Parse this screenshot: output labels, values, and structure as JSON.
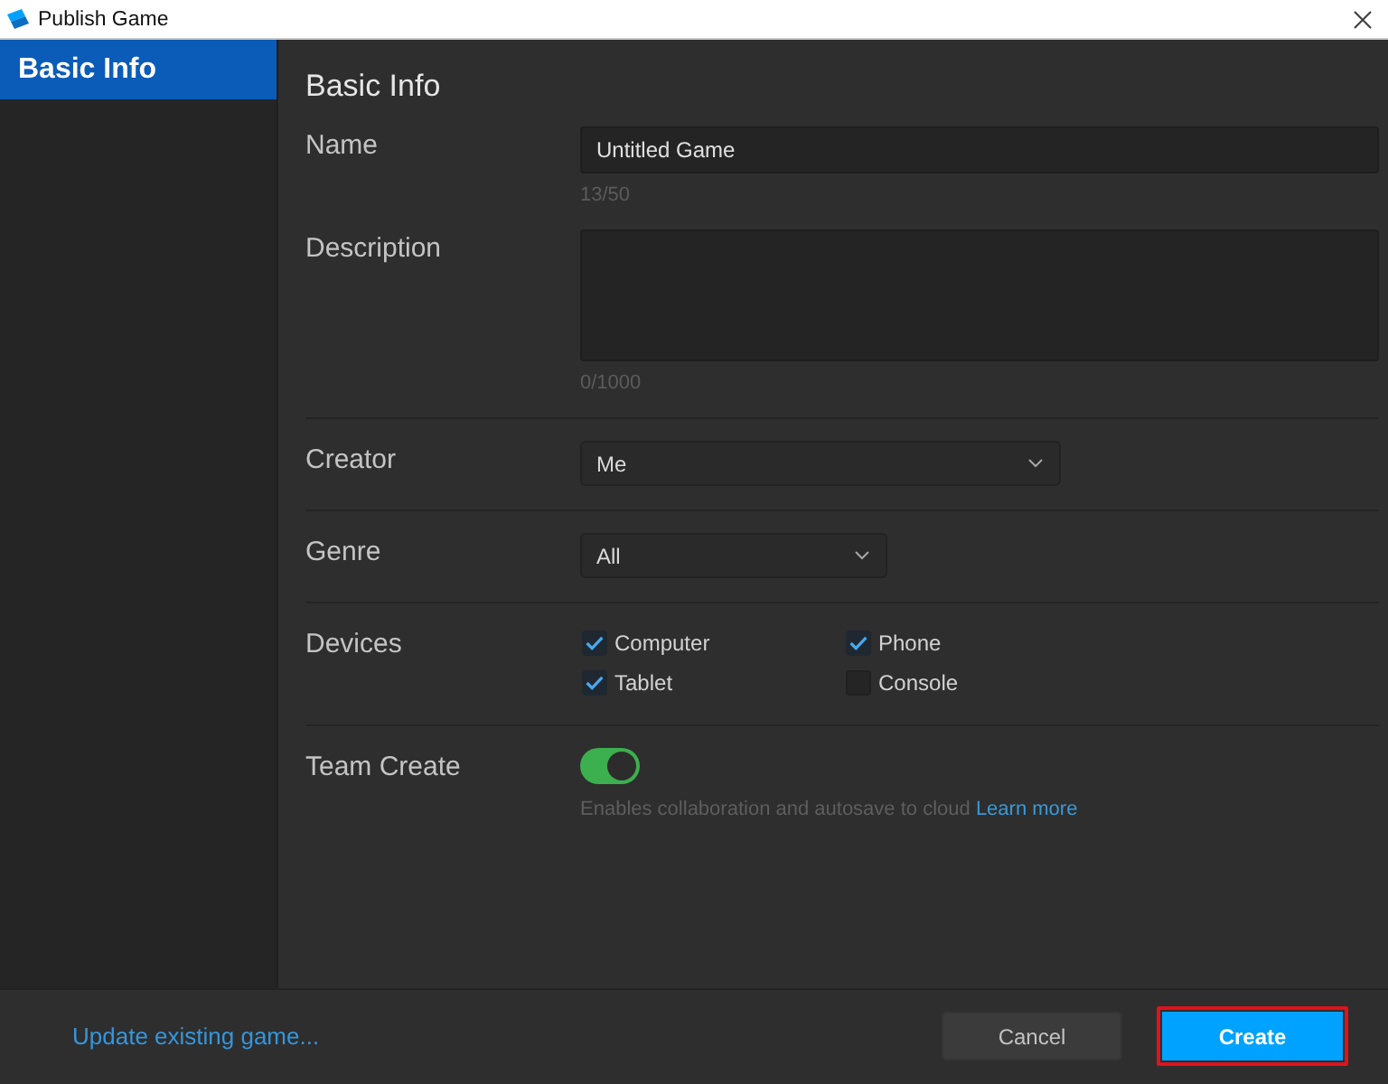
{
  "window": {
    "title": "Publish Game"
  },
  "sidebar": {
    "items": [
      {
        "label": "Basic Info",
        "selected": true
      }
    ]
  },
  "form": {
    "heading": "Basic Info",
    "sections": [
      {
        "fields": [
          {
            "kind": "text",
            "label": "Name",
            "value": "Untitled Game",
            "counter": "13/50"
          },
          {
            "kind": "textarea",
            "label": "Description",
            "counter": "0/1000"
          }
        ]
      },
      {
        "fields": [
          {
            "kind": "dropdown",
            "label": "Creator",
            "value": "Me"
          }
        ]
      },
      {
        "fields": [
          {
            "kind": "dropdown",
            "label": "Genre",
            "value": "All"
          }
        ]
      },
      {
        "fields": [
          {
            "kind": "checkboxes",
            "label": "Devices",
            "options": [
              {
                "label": "Computer",
                "checked": true
              },
              {
                "label": "Phone",
                "checked": true
              },
              {
                "label": "Tablet",
                "checked": true
              },
              {
                "label": "Console",
                "checked": false
              }
            ]
          }
        ]
      },
      {
        "fields": [
          {
            "kind": "toggle",
            "label": "Team Create",
            "on": true,
            "help": "Enables collaboration and autosave to cloud",
            "link": "Learn more"
          }
        ]
      }
    ]
  },
  "footer": {
    "link": "Update existing game...",
    "buttons": [
      {
        "label": "Cancel",
        "kind": "secondary",
        "highlighted": false
      },
      {
        "label": "Create",
        "kind": "primary",
        "highlighted": true
      }
    ]
  }
}
